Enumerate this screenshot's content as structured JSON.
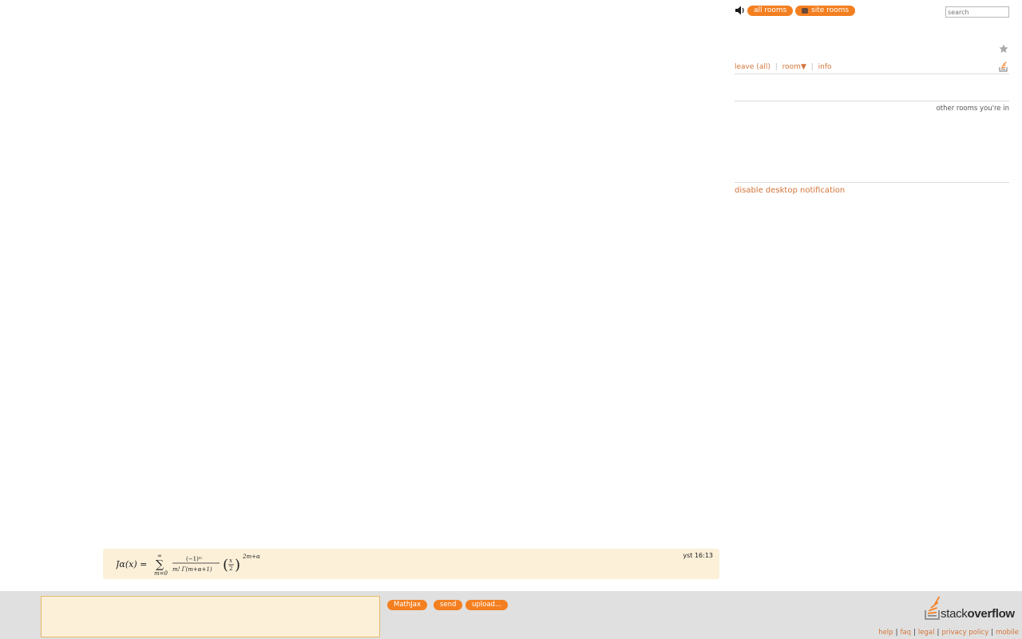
{
  "colors": {
    "accent": "#f47f20",
    "link": "#d2743a",
    "message_bg": "#fcf0d9",
    "footer_bg": "#e0e0e0"
  },
  "sidebar": {
    "all_rooms_label": "all rooms",
    "site_rooms_label": "site rooms",
    "search_placeholder": "search",
    "room_menu": {
      "leave": "leave",
      "all": "all",
      "room": "room▼",
      "info": "info"
    },
    "other_rooms_label": "other rooms you're in",
    "disable_notification": "disable desktop notification"
  },
  "message": {
    "formula": {
      "lhs": "Jα(x) =",
      "sum_top": "∞",
      "sum_sign": "∑",
      "sum_bottom": "m=0",
      "numerator": "(−1)ᵐ",
      "denominator": "m! Γ(m+α+1)",
      "inner_num": "x",
      "inner_den": "2",
      "exponent": "2m+α"
    },
    "timestamp": "yst 16:13"
  },
  "composer": {
    "input_value": "",
    "mathjax_label": "MathJax",
    "send_label": "send",
    "upload_label": "upload..."
  },
  "logo": {
    "word_light": "stack",
    "word_bold": "overflow"
  },
  "footer_links": [
    "help",
    "faq",
    "legal",
    "privacy policy",
    "mobile"
  ]
}
